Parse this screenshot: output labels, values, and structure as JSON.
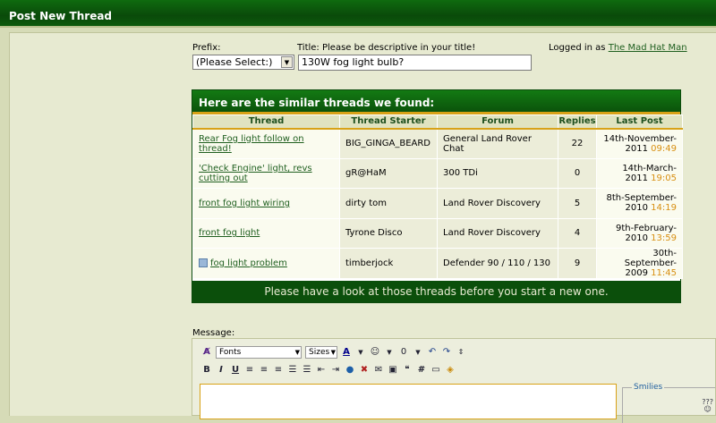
{
  "header": {
    "title": "Post New Thread"
  },
  "form": {
    "prefix_label": "Prefix:",
    "prefix_value": "(Please Select:)",
    "title_label": "Title: Please be descriptive in your title!",
    "title_value": "130W fog light bulb?",
    "logged_in_prefix": "Logged in as",
    "username": "The Mad Hat Man"
  },
  "similar": {
    "heading": "Here are the similar threads we found:",
    "columns": [
      "Thread",
      "Thread Starter",
      "Forum",
      "Replies",
      "Last Post"
    ],
    "rows": [
      {
        "thread": "Rear Fog light follow on thread!",
        "starter": "BIG_GINGA_BEARD",
        "forum": "General Land Rover Chat",
        "replies": "22",
        "date": "14th-November-2011",
        "time": "09:49"
      },
      {
        "thread": "'Check Engine' light, revs cutting out",
        "starter": "gR@HaM",
        "forum": "300 TDi",
        "replies": "0",
        "date": "14th-March-2011",
        "time": "19:05"
      },
      {
        "thread": "front fog light wiring",
        "starter": "dirty tom",
        "forum": "Land Rover Discovery",
        "replies": "5",
        "date": "8th-September-2010",
        "time": "14:19"
      },
      {
        "thread": "front fog light",
        "starter": "Tyrone Disco",
        "forum": "Land Rover Discovery",
        "replies": "4",
        "date": "9th-February-2010",
        "time": "13:59"
      },
      {
        "thread": "fog light problem",
        "starter": "timberjock",
        "forum": "Defender 90 / 110 / 130",
        "replies": "9",
        "date": "30th-September-2009",
        "time": "11:45"
      }
    ],
    "footer": "Please have a look at those threads before you start a new one."
  },
  "editor": {
    "message_label": "Message:",
    "font_select": "Fonts",
    "size_select": "Sizes",
    "bold": "B",
    "italic": "I",
    "underline": "U",
    "hash": "#",
    "smilies_label": "Smilies"
  }
}
